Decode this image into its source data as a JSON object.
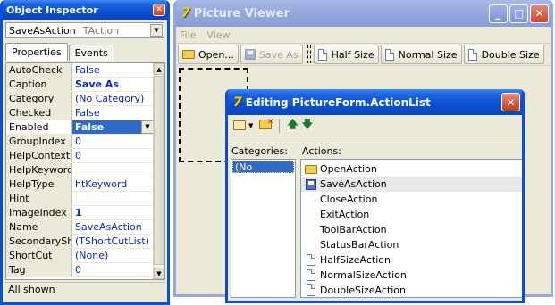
{
  "object_inspector": {
    "title": "Object Inspector",
    "component_name": "SaveAsAction",
    "component_type": "TAction",
    "tabs": [
      "Properties",
      "Events"
    ],
    "properties": [
      {
        "key": "AutoCheck",
        "value": "False",
        "bold": false
      },
      {
        "key": "Caption",
        "value": "Save As",
        "bold": true
      },
      {
        "key": "Category",
        "value": "(No Category)",
        "bold": false
      },
      {
        "key": "Checked",
        "value": "False",
        "bold": false
      },
      {
        "key": "Enabled",
        "value": "False",
        "bold": true,
        "editing": true
      },
      {
        "key": "GroupIndex",
        "value": "0",
        "bold": false
      },
      {
        "key": "HelpContext",
        "value": "0",
        "bold": false
      },
      {
        "key": "HelpKeyword",
        "value": "",
        "bold": false
      },
      {
        "key": "HelpType",
        "value": "htKeyword",
        "bold": false
      },
      {
        "key": "Hint",
        "value": "",
        "bold": false
      },
      {
        "key": "ImageIndex",
        "value": "1",
        "bold": true
      },
      {
        "key": "Name",
        "value": "SaveAsAction",
        "bold": false
      },
      {
        "key": "SecondaryShor",
        "value": "(TShortCutList)",
        "bold": false
      },
      {
        "key": "ShortCut",
        "value": "(None)",
        "bold": false
      },
      {
        "key": "Tag",
        "value": "0",
        "bold": false
      }
    ],
    "status": "All shown"
  },
  "picture_viewer": {
    "title": "Picture Viewer",
    "menu": [
      "File",
      "View"
    ],
    "toolbar": [
      {
        "label": "Open...",
        "icon": "folder-icon",
        "disabled": false
      },
      {
        "label": "Save As",
        "icon": "disk-icon",
        "disabled": true
      },
      {
        "label": "Half Size",
        "icon": "document-icon",
        "disabled": false
      },
      {
        "label": "Normal Size",
        "icon": "document-icon",
        "disabled": false
      },
      {
        "label": "Double Size",
        "icon": "document-icon",
        "disabled": false
      }
    ]
  },
  "action_list_editor": {
    "title": "Editing PictureForm.ActionList",
    "categories_label": "Categories:",
    "actions_label": "Actions:",
    "categories": [
      "(No Category)"
    ],
    "actions": [
      {
        "label": "OpenAction",
        "icon": "folder-icon"
      },
      {
        "label": "SaveAsAction",
        "icon": "disk-icon",
        "selected": true
      },
      {
        "label": "CloseAction",
        "icon": ""
      },
      {
        "label": "ExitAction",
        "icon": ""
      },
      {
        "label": "ToolBarAction",
        "icon": ""
      },
      {
        "label": "StatusBarAction",
        "icon": ""
      },
      {
        "label": "HalfSizeAction",
        "icon": "document-icon"
      },
      {
        "label": "NormalSizeAction",
        "icon": "document-icon"
      },
      {
        "label": "DoubleSizeAction",
        "icon": "document-icon"
      }
    ]
  },
  "colors": {
    "xp_blue": "#0a4fd0",
    "value_blue": "#0a2aa8",
    "selection": "#316ac5",
    "face": "#ece9d8"
  }
}
